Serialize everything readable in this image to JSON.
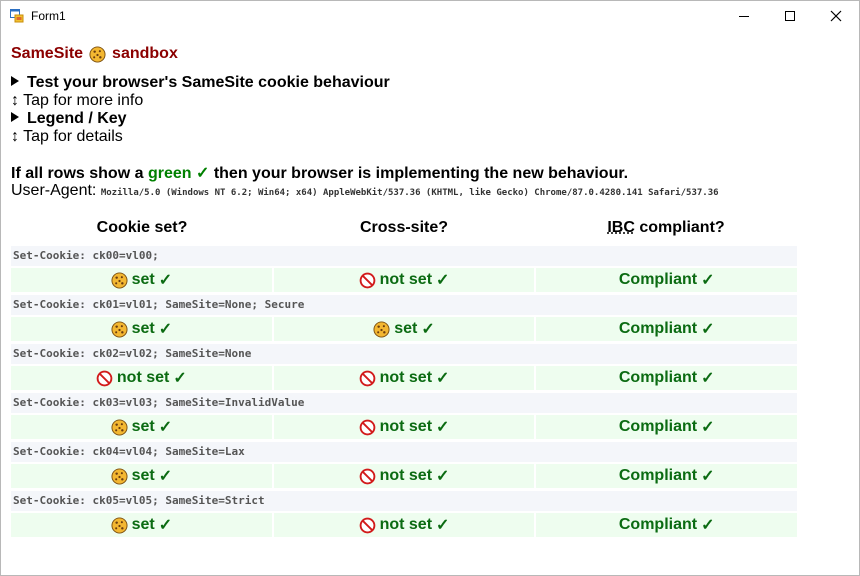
{
  "window": {
    "title": "Form1"
  },
  "page": {
    "heading_left": "SameSite",
    "heading_right": "sandbox",
    "test_summary": "Test your browser's SameSite cookie behaviour",
    "test_tap": "Tap for more info",
    "legend_summary": "Legend / Key",
    "legend_tap": "Tap for details",
    "tap_glyph": "↕",
    "result_prefix": "If all rows show a",
    "result_green": "green",
    "result_suffix": "then your browser is implementing the new behaviour.",
    "check_mark": "✓",
    "ua_label": "User-Agent:",
    "ua_value": "Mozilla/5.0 (Windows NT 6.2; Win64; x64) AppleWebKit/537.36 (KHTML, like Gecko) Chrome/87.0.4280.141 Safari/537.36"
  },
  "table": {
    "headers": {
      "cookie_set": "Cookie set?",
      "cross_site": "Cross-site?",
      "ibc_abbr": "IBC",
      "ibc_rest": " compliant?"
    },
    "rows": [
      {
        "cookie": "Set-Cookie: ck00=vl00;",
        "cookie_set": "set",
        "cookie_set_icon": "cookie-icon",
        "cross_site": "not set",
        "cross_site_icon": "no-entry-icon",
        "compliant": "Compliant"
      },
      {
        "cookie": "Set-Cookie: ck01=vl01; SameSite=None; Secure",
        "cookie_set": "set",
        "cookie_set_icon": "cookie-icon",
        "cross_site": "set",
        "cross_site_icon": "cookie-icon",
        "compliant": "Compliant"
      },
      {
        "cookie": "Set-Cookie: ck02=vl02; SameSite=None",
        "cookie_set": "not set",
        "cookie_set_icon": "no-entry-icon",
        "cross_site": "not set",
        "cross_site_icon": "no-entry-icon",
        "compliant": "Compliant"
      },
      {
        "cookie": "Set-Cookie: ck03=vl03; SameSite=InvalidValue",
        "cookie_set": "set",
        "cookie_set_icon": "cookie-icon",
        "cross_site": "not set",
        "cross_site_icon": "no-entry-icon",
        "compliant": "Compliant"
      },
      {
        "cookie": "Set-Cookie: ck04=vl04; SameSite=Lax",
        "cookie_set": "set",
        "cookie_set_icon": "cookie-icon",
        "cross_site": "not set",
        "cross_site_icon": "no-entry-icon",
        "compliant": "Compliant"
      },
      {
        "cookie": "Set-Cookie: ck05=vl05; SameSite=Strict",
        "cookie_set": "set",
        "cookie_set_icon": "cookie-icon",
        "cross_site": "not set",
        "cross_site_icon": "no-entry-icon",
        "compliant": "Compliant"
      }
    ]
  },
  "colors": {
    "heading": "#8b0000",
    "green": "#008000",
    "cell_bg": "#eefdef",
    "cookie_bg": "#f4f6fa"
  }
}
